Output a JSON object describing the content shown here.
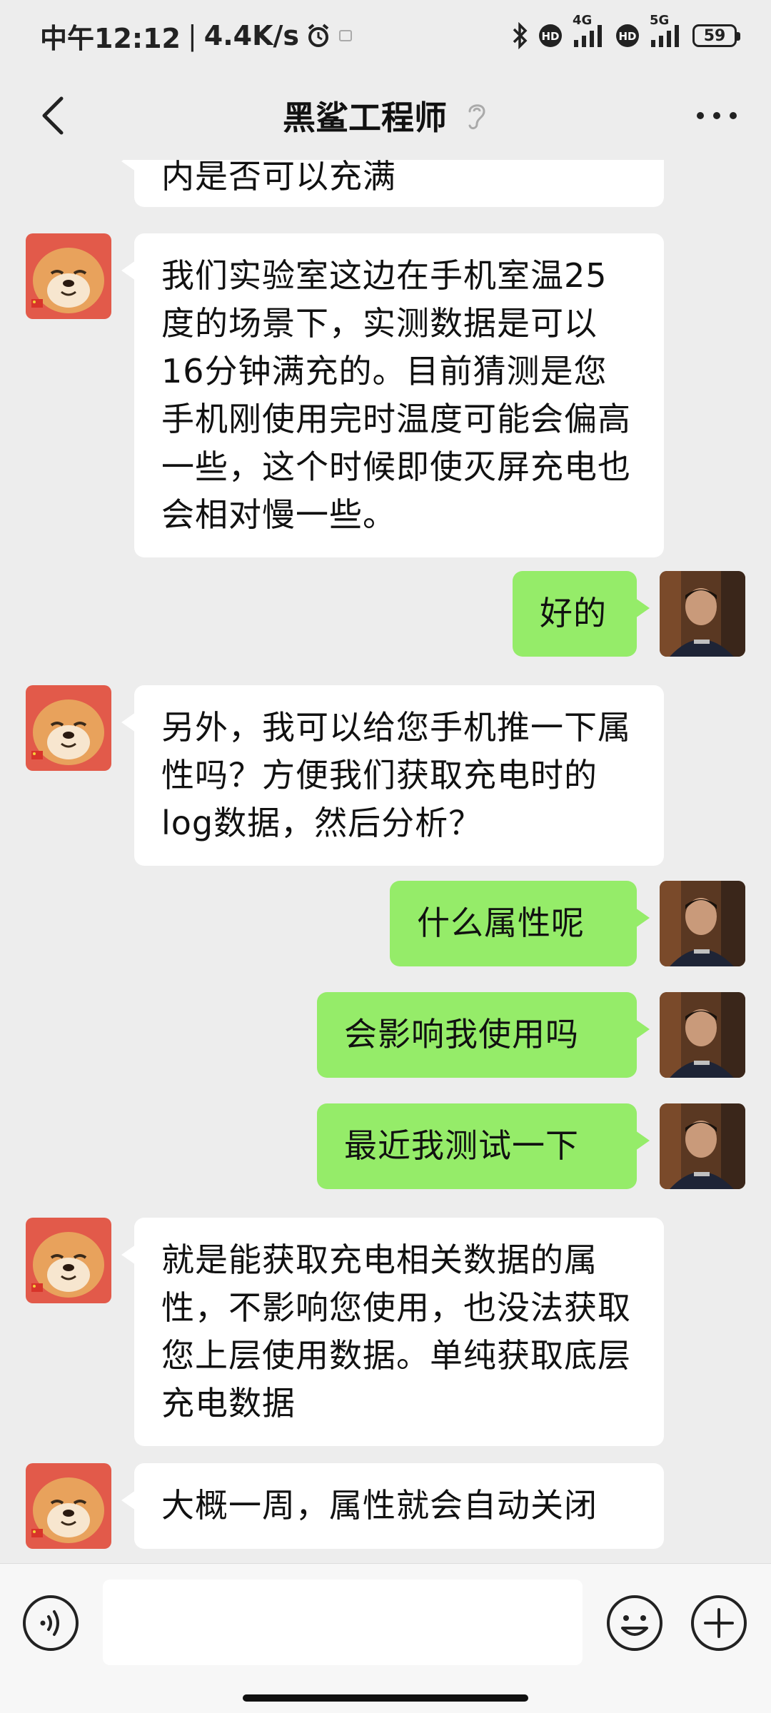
{
  "status_bar": {
    "time": "中午12:12",
    "separator": "|",
    "speed": "4.4K/s",
    "net1": "4G",
    "net2": "5G",
    "battery": "59"
  },
  "header": {
    "title": "黑鲨工程师"
  },
  "messages": [
    {
      "side": "left",
      "text": "内是否可以充满"
    },
    {
      "side": "left",
      "text": "我们实验室这边在手机室温25度的场景下，实测数据是可以16分钟满充的。目前猜测是您手机刚使用完时温度可能会偏高一些，这个时候即使灭屏充电也会相对慢一些。"
    },
    {
      "side": "right",
      "text": "好的"
    },
    {
      "side": "left",
      "text": "另外，我可以给您手机推一下属性吗？方便我们获取充电时的log数据，然后分析？"
    },
    {
      "side": "right",
      "text": "什么属性呢"
    },
    {
      "side": "right",
      "text": "会影响我使用吗"
    },
    {
      "side": "right",
      "text": "最近我测试一下"
    },
    {
      "side": "left",
      "text": "就是能获取充电相关数据的属性，不影响您使用，也没法获取您上层使用数据。单纯获取底层充电数据"
    },
    {
      "side": "left",
      "text": "大概一周，属性就会自动关闭"
    }
  ],
  "icons": {
    "back": "chevron-left-icon",
    "ear": "ear-icon",
    "more": "more-dots-icon",
    "voice": "voice-icon",
    "emoji": "emoji-icon",
    "plus": "plus-icon"
  },
  "colors": {
    "background": "#ededed",
    "bubble_self": "#95ec69",
    "bubble_other": "#ffffff"
  }
}
